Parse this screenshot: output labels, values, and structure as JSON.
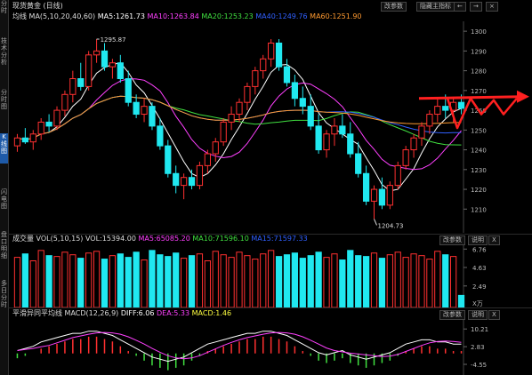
{
  "sidebar": {
    "items": [
      {
        "label": "分时",
        "top": 0
      },
      {
        "label": "技术分析",
        "top": 42
      },
      {
        "label": "分时图",
        "top": 100
      },
      {
        "label": "K线图",
        "top": 150
      },
      {
        "label": "闪电图",
        "top": 212
      },
      {
        "label": "盘口明细",
        "top": 260
      },
      {
        "label": "多日分时",
        "top": 315
      }
    ],
    "active_index": 3
  },
  "header": {
    "title": "现货黄金",
    "period": "(日线)",
    "buttons": {
      "modify_params": "改参数",
      "expand_indicator": "隐藏主指标"
    },
    "nav": {
      "back": "←",
      "forward": "→",
      "close": "×"
    }
  },
  "main": {
    "indicator_name": "均线",
    "indicator_params": "MA(5,10,20,40,60)",
    "ma_values": [
      {
        "label": "MA5:1261.73",
        "color": "#ffffff"
      },
      {
        "label": "MA10:1263.84",
        "color": "#ff40ff"
      },
      {
        "label": "MA20:1253.23",
        "color": "#40e040"
      },
      {
        "label": "MA40:1249.76",
        "color": "#3060ff"
      },
      {
        "label": "MA60:1251.90",
        "color": "#ff9a30"
      }
    ],
    "high_label": "1295.87",
    "low_label": "1204.73",
    "y_ticks": [
      "1300",
      "1290",
      "1280",
      "1270",
      "1260",
      "1250",
      "1240",
      "1230",
      "1220",
      "1210"
    ]
  },
  "vol": {
    "title": "成交量",
    "params": "VOL(5,10,15)",
    "vol_value": "VOL:15394.00",
    "ma_values": [
      {
        "label": "MA5:65085.20",
        "color": "#ff40ff"
      },
      {
        "label": "MA10:71596.10",
        "color": "#40e040"
      },
      {
        "label": "MA15:71597.33",
        "color": "#3060ff"
      }
    ],
    "buttons": {
      "modify_params": "改参数",
      "help": "说明",
      "close": "X"
    },
    "y_ticks": [
      "6.76",
      "4.63",
      "2.49"
    ],
    "unit": "X万"
  },
  "macd": {
    "title": "平滑异同平均线",
    "params": "MACD(12,26,9)",
    "diff": {
      "label": "DIFF:6.06",
      "color": "#ffffff"
    },
    "dea": {
      "label": "DEA:5.33",
      "color": "#ff40ff"
    },
    "macd": {
      "label": "MACD:1.46",
      "color": "#ffff40"
    },
    "buttons": {
      "modify_params": "改参数",
      "help": "说明",
      "close": "X"
    },
    "y_ticks": [
      "10.21",
      "2.83",
      "-4.55"
    ]
  },
  "colors": {
    "up": "#ff3030",
    "down": "#20e8f0",
    "ma5": "#ffffff",
    "ma10": "#ff40ff",
    "ma20": "#40e040",
    "ma40": "#3060ff",
    "ma60": "#ff9a30",
    "annotation": "#ff2020"
  },
  "chart_data": {
    "type": "candlestick",
    "y_range": [
      1198,
      1305
    ],
    "candles": [
      [
        1242,
        1248,
        1239,
        1246
      ],
      [
        1246,
        1251,
        1243,
        1244
      ],
      [
        1244,
        1250,
        1240,
        1248
      ],
      [
        1248,
        1256,
        1245,
        1254
      ],
      [
        1254,
        1258,
        1249,
        1252
      ],
      [
        1252,
        1262,
        1250,
        1260
      ],
      [
        1260,
        1270,
        1257,
        1268
      ],
      [
        1268,
        1280,
        1264,
        1276
      ],
      [
        1276,
        1284,
        1270,
        1272
      ],
      [
        1272,
        1290,
        1270,
        1288
      ],
      [
        1288,
        1296,
        1284,
        1290
      ],
      [
        1290,
        1294,
        1280,
        1282
      ],
      [
        1282,
        1286,
        1276,
        1284
      ],
      [
        1284,
        1288,
        1274,
        1276
      ],
      [
        1276,
        1280,
        1262,
        1264
      ],
      [
        1264,
        1268,
        1256,
        1258
      ],
      [
        1258,
        1266,
        1254,
        1262
      ],
      [
        1262,
        1264,
        1250,
        1252
      ],
      [
        1252,
        1256,
        1240,
        1242
      ],
      [
        1242,
        1245,
        1226,
        1228
      ],
      [
        1228,
        1232,
        1218,
        1222
      ],
      [
        1222,
        1228,
        1215,
        1226
      ],
      [
        1226,
        1230,
        1220,
        1222
      ],
      [
        1222,
        1234,
        1220,
        1232
      ],
      [
        1232,
        1240,
        1228,
        1238
      ],
      [
        1238,
        1246,
        1234,
        1244
      ],
      [
        1244,
        1256,
        1242,
        1254
      ],
      [
        1254,
        1262,
        1250,
        1258
      ],
      [
        1258,
        1266,
        1254,
        1264
      ],
      [
        1264,
        1274,
        1260,
        1272
      ],
      [
        1272,
        1282,
        1268,
        1280
      ],
      [
        1280,
        1288,
        1276,
        1286
      ],
      [
        1286,
        1296,
        1282,
        1294
      ],
      [
        1294,
        1296,
        1280,
        1282
      ],
      [
        1282,
        1286,
        1272,
        1274
      ],
      [
        1274,
        1278,
        1262,
        1266
      ],
      [
        1266,
        1272,
        1258,
        1262
      ],
      [
        1262,
        1268,
        1250,
        1252
      ],
      [
        1252,
        1258,
        1238,
        1240
      ],
      [
        1240,
        1250,
        1236,
        1248
      ],
      [
        1248,
        1256,
        1242,
        1252
      ],
      [
        1252,
        1258,
        1246,
        1248
      ],
      [
        1248,
        1254,
        1236,
        1238
      ],
      [
        1238,
        1244,
        1226,
        1228
      ],
      [
        1228,
        1232,
        1212,
        1214
      ],
      [
        1214,
        1222,
        1205,
        1220
      ],
      [
        1220,
        1226,
        1210,
        1212
      ],
      [
        1212,
        1224,
        1210,
        1222
      ],
      [
        1222,
        1234,
        1220,
        1232
      ],
      [
        1232,
        1242,
        1230,
        1240
      ],
      [
        1240,
        1248,
        1236,
        1246
      ],
      [
        1246,
        1254,
        1242,
        1252
      ],
      [
        1252,
        1260,
        1248,
        1258
      ],
      [
        1258,
        1266,
        1254,
        1262
      ],
      [
        1262,
        1268,
        1256,
        1260
      ],
      [
        1260,
        1266,
        1254,
        1264
      ],
      [
        1264,
        1268,
        1258,
        1261
      ]
    ],
    "volumes": [
      5.8,
      6.2,
      5.4,
      6.6,
      6.0,
      5.9,
      6.4,
      6.1,
      5.7,
      6.3,
      6.5,
      5.6,
      6.0,
      6.2,
      5.8,
      6.4,
      5.5,
      6.6,
      6.1,
      5.9,
      6.3,
      5.7,
      6.0,
      6.2,
      5.4,
      6.5,
      6.1,
      5.8,
      6.4,
      6.0,
      5.6,
      6.2,
      6.6,
      5.9,
      6.1,
      6.3,
      5.7,
      6.0,
      6.4,
      5.8,
      6.2,
      5.5,
      6.6,
      6.0,
      5.9,
      6.3,
      5.7,
      6.1,
      6.4,
      5.8,
      6.2,
      6.0,
      5.6,
      6.5,
      6.1,
      5.9,
      1.4
    ],
    "macd": [
      -2,
      -1,
      0,
      2,
      3,
      4,
      5,
      6,
      6,
      7,
      7,
      6,
      5,
      3,
      1,
      -1,
      -3,
      -5,
      -6,
      -7,
      -6,
      -5,
      -3,
      -1,
      1,
      2,
      3,
      4,
      5,
      6,
      6,
      7,
      7,
      6,
      5,
      3,
      1,
      -1,
      -3,
      -4,
      -3,
      -2,
      -4,
      -5,
      -6,
      -5,
      -4,
      -3,
      -1,
      1,
      2,
      3,
      3,
      2,
      2,
      1,
      1
    ]
  }
}
